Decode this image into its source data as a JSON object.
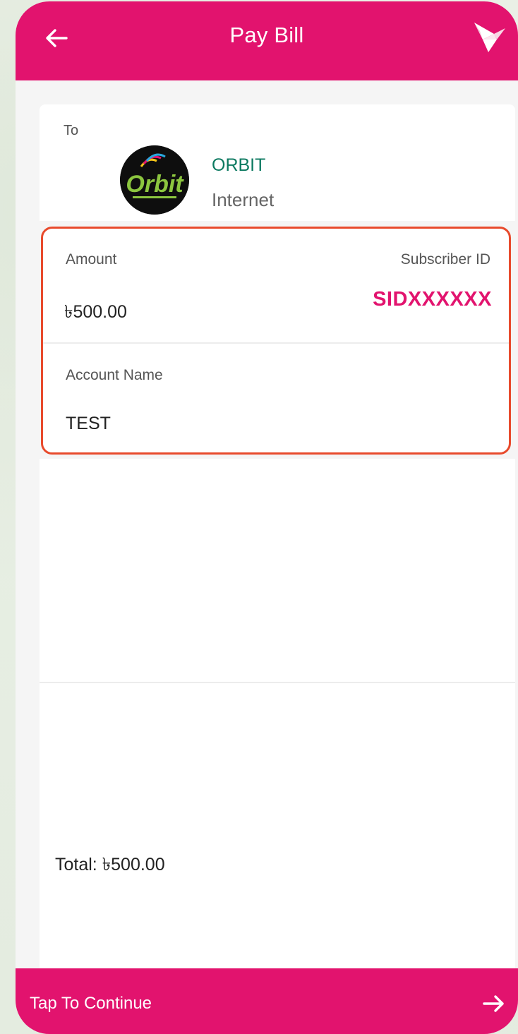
{
  "header": {
    "title": "Pay Bill",
    "back_icon": "arrow-left-icon",
    "logo_icon": "bird-logo-icon",
    "color": "#e2136e"
  },
  "recipient": {
    "to_label": "To",
    "biller_name": "ORBIT",
    "biller_type": "Internet",
    "logo_text": "Orbit"
  },
  "details": {
    "amount_label": "Amount",
    "amount_value": "৳500.00",
    "subscriber_id_label": "Subscriber ID",
    "subscriber_id_value": "SIDXXXXXX",
    "account_name_label": "Account Name",
    "account_name_value": "TEST",
    "highlight_color": "#e84a2c"
  },
  "summary": {
    "total_text": "Total: ৳500.00"
  },
  "footer": {
    "label": "Tap To Continue",
    "arrow_icon": "arrow-right-icon"
  }
}
